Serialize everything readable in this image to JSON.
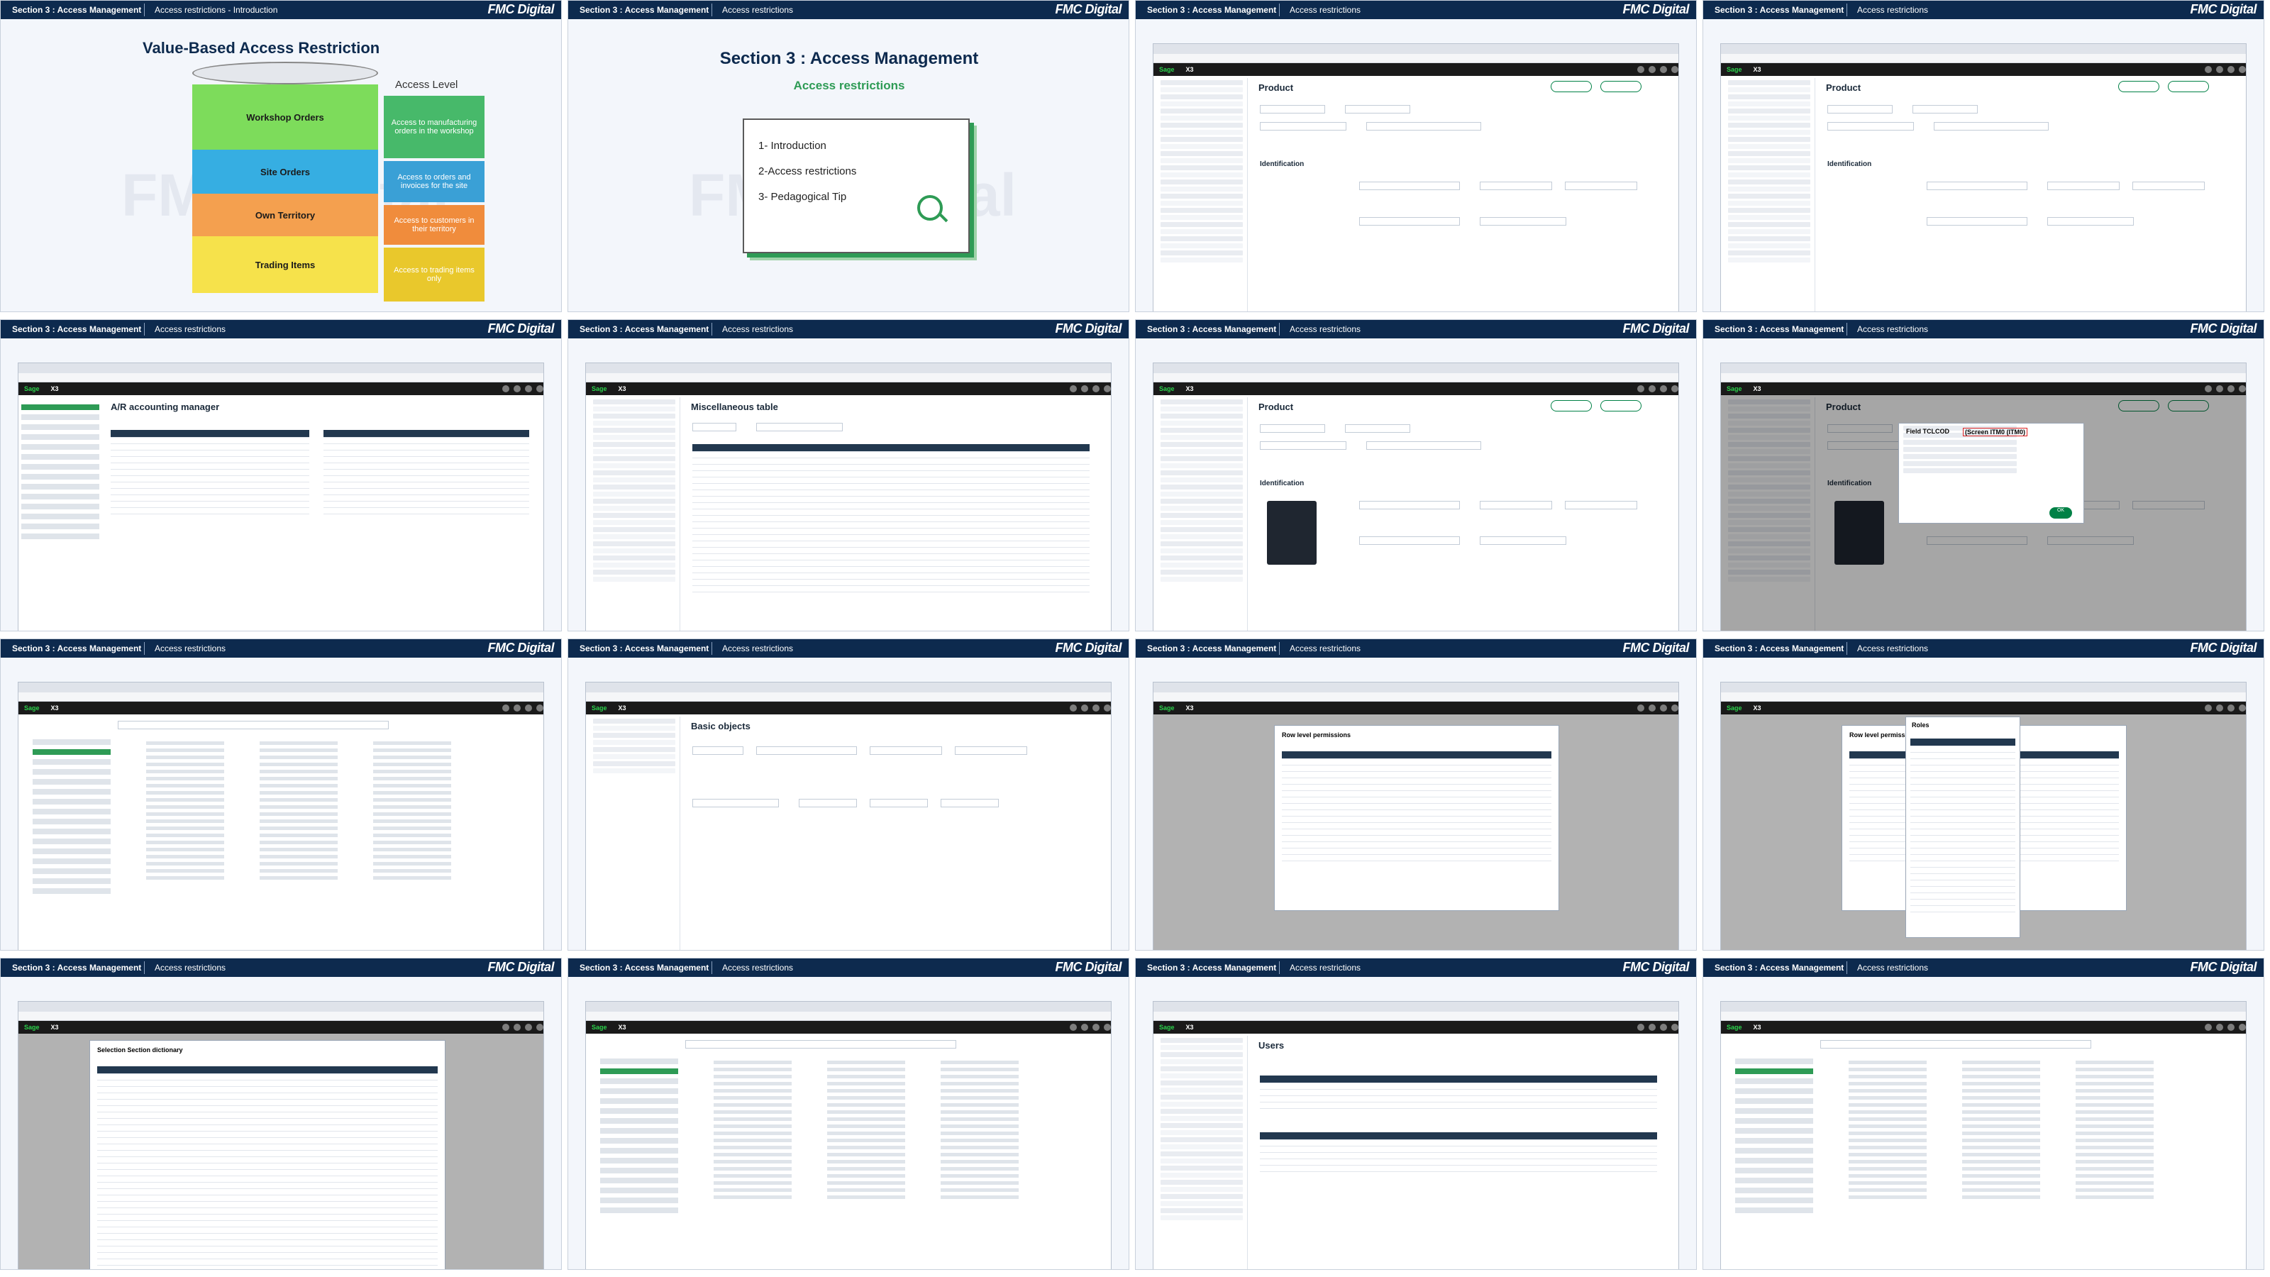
{
  "header": {
    "section": "Section 3 : Access Management",
    "logo": "FMC Digital",
    "slide_subtitles": [
      "Access restrictions - Introduction",
      "Access restrictions",
      "Access restrictions",
      "Access restrictions",
      "Access restrictions",
      "Access restrictions",
      "Access restrictions",
      "Access restrictions",
      "Access restrictions",
      "Access restrictions",
      "Access restrictions",
      "Access restrictions",
      "Access restrictions",
      "Access restrictions",
      "Access restrictions",
      "Access restrictions"
    ]
  },
  "watermark": "FMC Digital",
  "slide1": {
    "title": "Value-Based Access Restriction",
    "access_level": "Access Level",
    "levels": [
      {
        "name": "Workshop Orders",
        "access": "Access to manufacturing orders in the workshop",
        "color": "#7ddc5b",
        "access_color": "#47b96a"
      },
      {
        "name": "Site Orders",
        "access": "Access to orders and invoices for the site",
        "color": "#36aee2",
        "access_color": "#3aa0d6"
      },
      {
        "name": "Own Territory",
        "access": "Access to customers in their territory",
        "color": "#f4a04f",
        "access_color": "#f08c3c"
      },
      {
        "name": "Trading Items",
        "access": "Access to trading items only",
        "color": "#f6e24b",
        "access_color": "#e9c82c"
      }
    ]
  },
  "slide2": {
    "title": "Section 3 : Access Management",
    "subtitle": "Access restrictions",
    "items": [
      "1- Introduction",
      "2-Access restrictions",
      "3- Pedagogical Tip"
    ]
  },
  "screens": {
    "product": "Product",
    "ar_manager": "A/R accounting manager",
    "misc_table": "Miscellaneous table",
    "field_dialog": "Field TCLCOD",
    "field_dialog_screen": "(Screen ITM0 (ITM0)",
    "basic_objects": "Basic objects",
    "row_level_permissions": "Row level permissions",
    "roles": "Roles",
    "selection_section_dictionary": "Selection Section dictionary",
    "users": "Users",
    "identification": "Identification",
    "ok": "OK"
  },
  "colors": {
    "header_bg": "#0d2a4e",
    "accent_green": "#2e9b55",
    "app_bar": "#1a1a1a"
  }
}
